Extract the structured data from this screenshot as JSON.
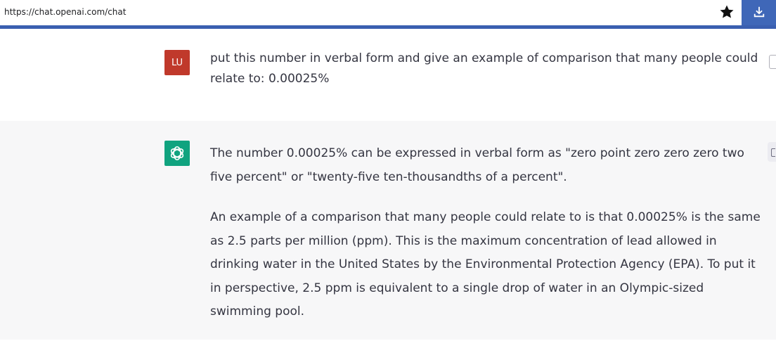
{
  "browser": {
    "url": "https://chat.openai.com/chat"
  },
  "conversation": {
    "user": {
      "avatar_initials": "LU",
      "avatar_color": "#c0392b",
      "message": "put this number in verbal form and give an example of comparison that many people could relate to: 0.00025%"
    },
    "assistant": {
      "avatar_color": "#10a37f",
      "paragraphs": [
        "The number 0.00025% can be expressed in verbal form as \"zero point zero zero zero two five percent\" or \"twenty-five ten-thousandths of a percent\".",
        "An example of a comparison that many people could relate to is that 0.00025% is the same as 2.5 parts per million (ppm). This is the maximum concentration of lead allowed in drinking water in the United States by the Environmental Protection Agency (EPA). To put it in perspective, 2.5 ppm is equivalent to a single drop of water in an Olympic-sized swimming pool."
      ]
    }
  },
  "icons": {
    "bookmark": "star-icon",
    "download": "download-icon",
    "edit": "edit-icon",
    "feedback": "thumbs-up-icon",
    "assistant_logo": "openai-logo-icon"
  },
  "colors": {
    "accent_bar": "#3a5fb0",
    "assistant_bg": "#f7f7f8"
  }
}
